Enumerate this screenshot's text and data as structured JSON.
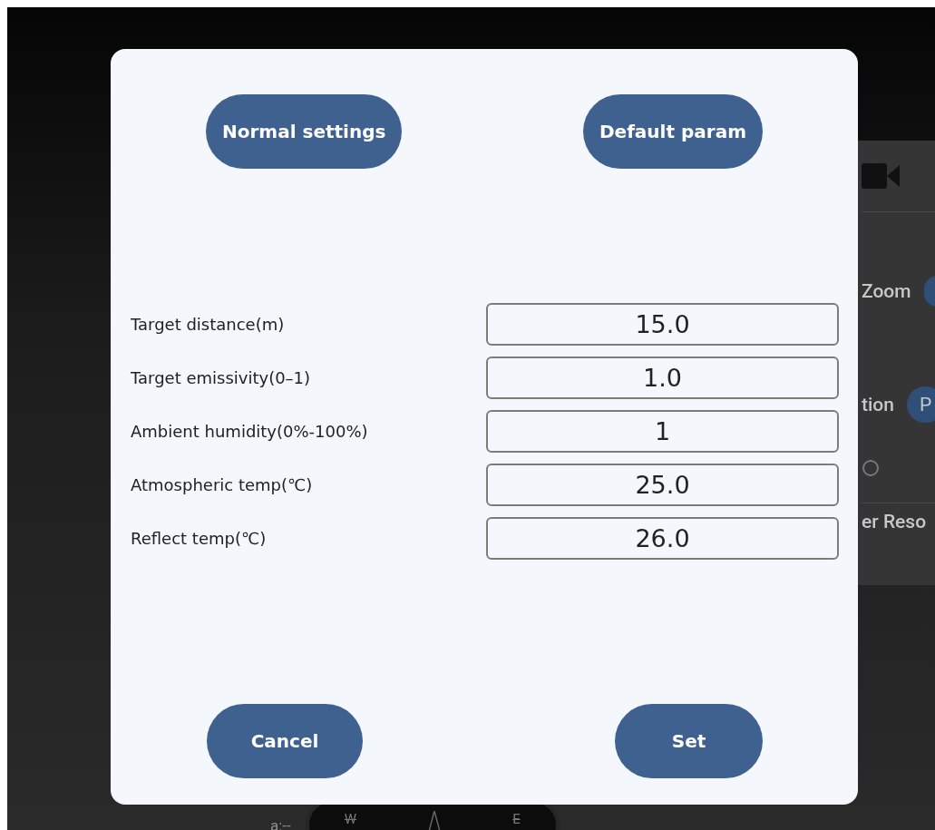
{
  "background": {
    "panel": {
      "zoom_label": "Zoom",
      "option_label": "tion",
      "option_button": "P",
      "resolution_label": "er Reso"
    },
    "compass": {
      "altitude": "a:--",
      "west": "W",
      "east": "E"
    }
  },
  "dialog": {
    "top_buttons": [
      "Normal settings",
      "Default param"
    ],
    "fields": [
      {
        "label": "Target distance(m)",
        "value": "15.0"
      },
      {
        "label": "Target emissivity(0–1)",
        "value": "1.0"
      },
      {
        "label": "Ambient humidity(0%-100%)",
        "value": "1"
      },
      {
        "label": "Atmospheric temp(℃)",
        "value": "25.0"
      },
      {
        "label": "Reflect temp(℃)",
        "value": "26.0"
      }
    ],
    "bottom_buttons": [
      "Cancel",
      "Set"
    ]
  }
}
